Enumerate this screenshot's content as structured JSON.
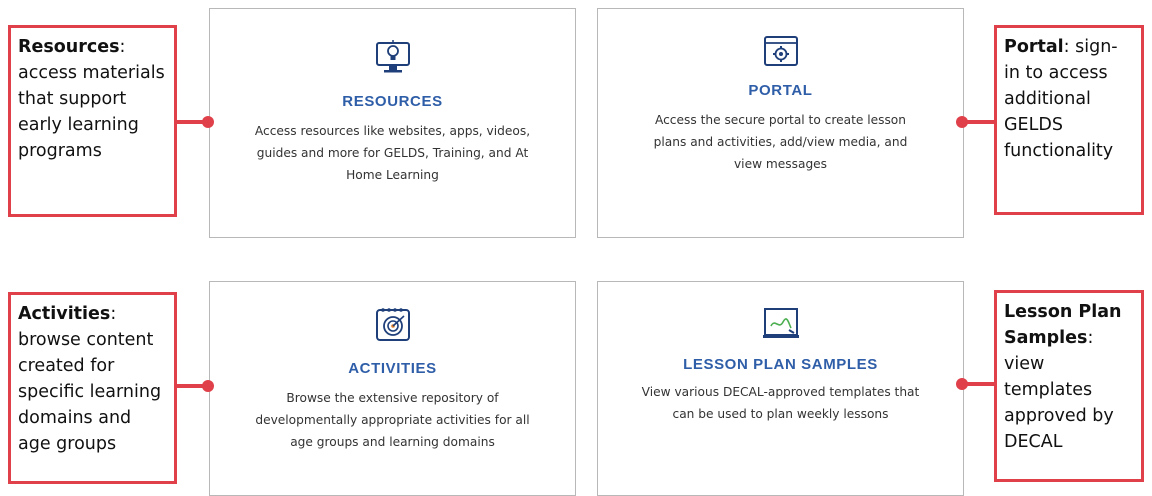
{
  "colors": {
    "accent": "#e0404a",
    "title_blue": "#2f5ea8",
    "icon_blue": "#1f3f7a"
  },
  "cards": [
    {
      "icon": "lightbulb-monitor-icon",
      "title": "RESOURCES",
      "desc": "Access resources like websites, apps, videos, guides and more for GELDS, Training, and At Home Learning"
    },
    {
      "icon": "gear-window-icon",
      "title": "PORTAL",
      "desc": "Access the secure portal to create lesson plans and activities, add/view media, and view messages"
    },
    {
      "icon": "target-calendar-icon",
      "title": "ACTIVITIES",
      "desc": "Browse the extensive repository of developmentally appropriate activities for all age groups and learning domains"
    },
    {
      "icon": "chalkboard-icon",
      "title": "LESSON PLAN SAMPLES",
      "desc": "View various DECAL-approved templates that can be used to plan weekly lessons"
    }
  ],
  "notes": [
    {
      "term": "Resources",
      "text": "access materials that support early learning programs"
    },
    {
      "term": "Portal",
      "text": " sign-in to access additional GELDS functionality"
    },
    {
      "term": "Activities",
      "text": "browse content created for specific learning domains and age groups"
    },
    {
      "term": "Lesson Plan Samples",
      "text": "view templates approved by DECAL"
    }
  ]
}
